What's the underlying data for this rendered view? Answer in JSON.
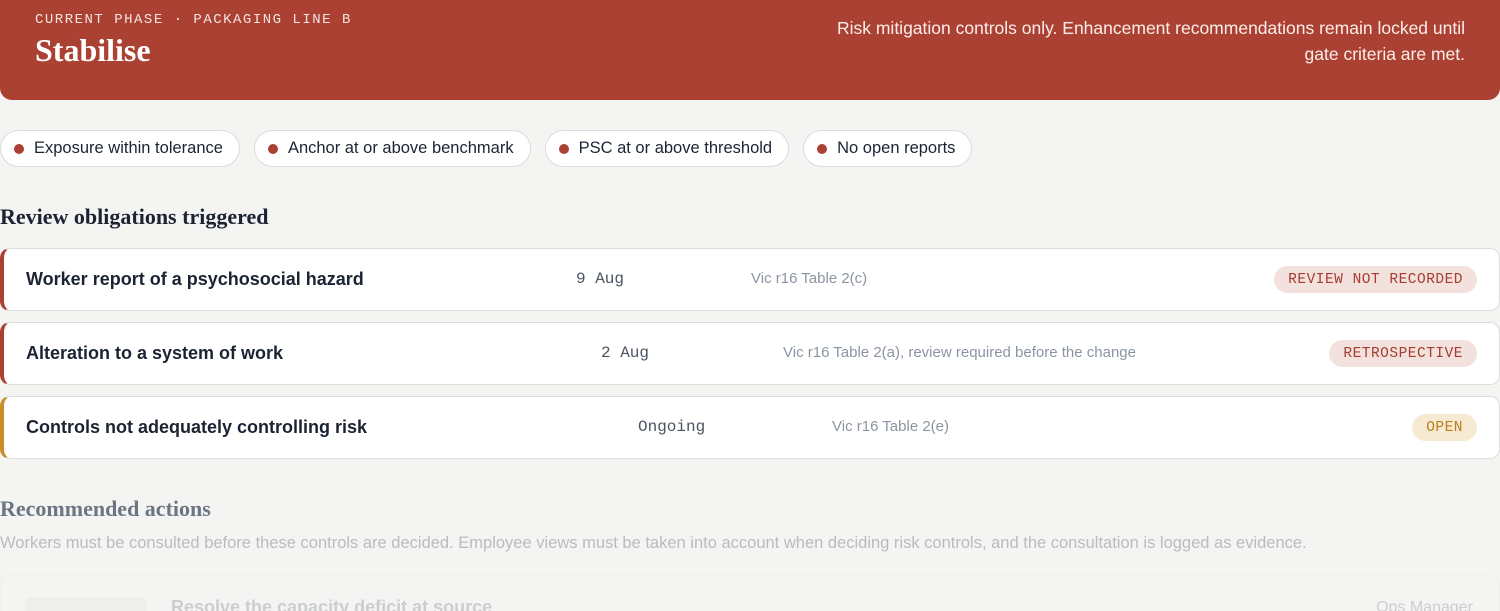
{
  "phase": {
    "label": "CURRENT PHASE · PACKAGING LINE B",
    "title": "Stabilise",
    "note": "Risk mitigation controls only. Enhancement recommendations remain locked until gate criteria are met."
  },
  "criteria": [
    {
      "label": "Exposure within tolerance"
    },
    {
      "label": "Anchor at or above benchmark"
    },
    {
      "label": "PSC at or above threshold"
    },
    {
      "label": "No open reports"
    }
  ],
  "obligations": {
    "title": "Review obligations triggered",
    "items": [
      {
        "title": "Worker report of a psychosocial hazard",
        "date": "9 Aug",
        "ref": "Vic r16 Table 2(c)",
        "status": "REVIEW NOT RECORDED"
      },
      {
        "title": "Alteration to a system of work",
        "date": "2 Aug",
        "ref": "Vic r16 Table 2(a), review required before the change",
        "status": "RETROSPECTIVE"
      },
      {
        "title": "Controls not adequately controlling risk",
        "date": "Ongoing",
        "ref": "Vic r16 Table 2(e)",
        "status": "OPEN"
      }
    ]
  },
  "recommended": {
    "title": "Recommended actions",
    "description": "Workers must be consulted before these controls are decided. Employee views must be taken into account when deciding risk controls, and the consultation is logged as evidence.",
    "items": [
      {
        "title": "Resolve the capacity deficit at source",
        "owner": "Ops Manager"
      }
    ]
  },
  "colors": {
    "accent": "#ab4133",
    "warning": "#c98d2a",
    "background": "#f4f4f2"
  }
}
